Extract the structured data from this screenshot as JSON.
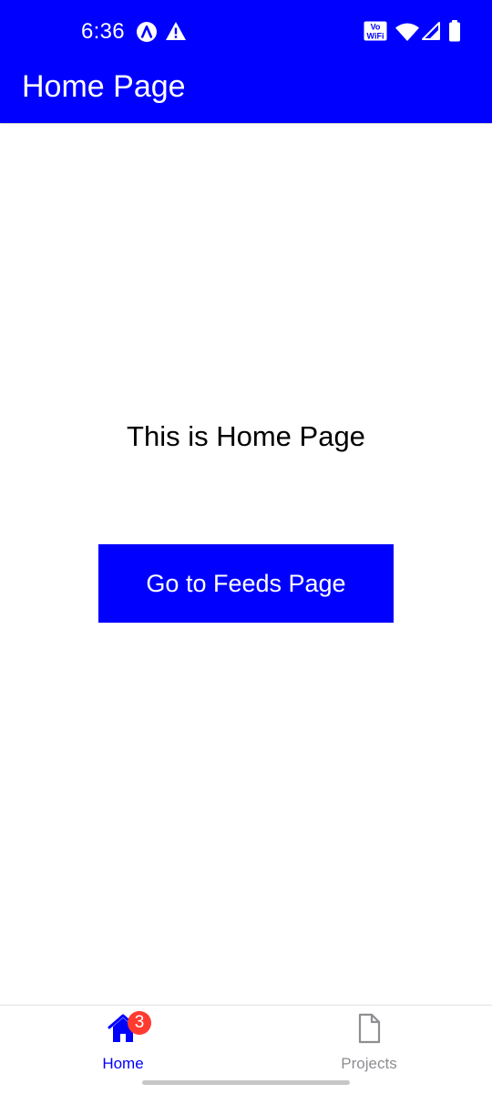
{
  "status_bar": {
    "time": "6:36",
    "vowifi_top": "Vo",
    "vowifi_bottom": "WiFi",
    "icons": [
      "app-notification-icon",
      "warning-icon",
      "vowifi-icon",
      "wifi-icon",
      "cellular-signal-icon",
      "battery-icon"
    ]
  },
  "app_bar": {
    "title": "Home Page"
  },
  "main": {
    "heading": "This is Home Page",
    "button_label": "Go to Feeds Page"
  },
  "tab_bar": {
    "tabs": [
      {
        "label": "Home",
        "icon": "home-icon",
        "badge": "3",
        "active": true
      },
      {
        "label": "Projects",
        "icon": "document-icon",
        "active": false
      }
    ],
    "active_color": "#0000ff",
    "inactive_color": "#8e8e93"
  },
  "colors": {
    "primary": "#0000ff",
    "badge": "#ff3b30",
    "background": "#ffffff"
  }
}
